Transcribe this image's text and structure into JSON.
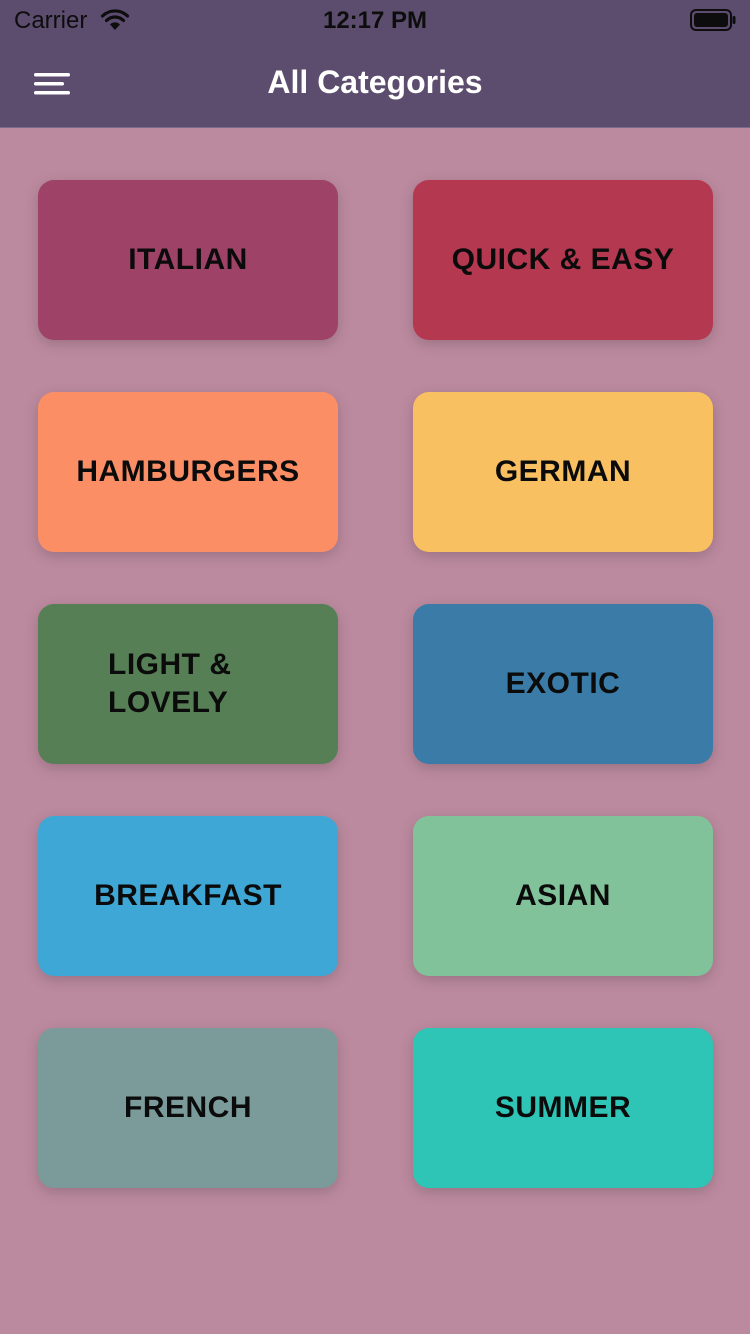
{
  "status_bar": {
    "carrier": "Carrier",
    "time": "12:17 PM"
  },
  "header": {
    "title": "All Categories",
    "menu_icon": "hamburger-menu-icon"
  },
  "colors": {
    "header_bg": "#5c4d6e",
    "page_bg": "#bc8a9f"
  },
  "categories": [
    {
      "label": "ITALIAN",
      "color": "#9e4268"
    },
    {
      "label": "QUICK & EASY",
      "color": "#b33850"
    },
    {
      "label": "HAMBURGERS",
      "color": "#fc8e66"
    },
    {
      "label": "GERMAN",
      "color": "#f9c062"
    },
    {
      "label": "LIGHT & LOVELY",
      "color": "#567f56"
    },
    {
      "label": "EXOTIC",
      "color": "#3a7ca7"
    },
    {
      "label": "BREAKFAST",
      "color": "#3ea7d6"
    },
    {
      "label": "ASIAN",
      "color": "#82c29b"
    },
    {
      "label": "FRENCH",
      "color": "#7b9b9b"
    },
    {
      "label": "SUMMER",
      "color": "#2ec4b6"
    }
  ]
}
